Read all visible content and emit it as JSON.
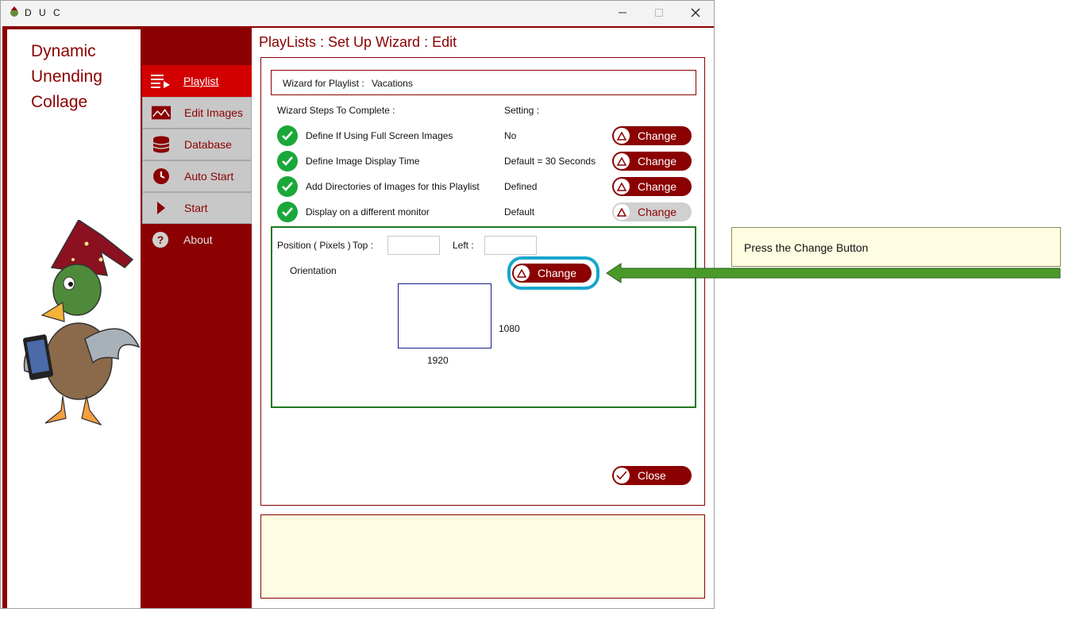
{
  "window": {
    "title": "D U C",
    "minimize_icon": "minimize-icon",
    "maximize_icon": "maximize-icon",
    "close_icon": "close-icon"
  },
  "brand": {
    "line1": "Dynamic",
    "line2": "Unending",
    "line3": "Collage",
    "mascot": "duck-wizard-mascot"
  },
  "nav": {
    "items": [
      {
        "label": "Playlist",
        "icon": "playlist-icon",
        "state": "active"
      },
      {
        "label": "Edit Images",
        "icon": "image-icon",
        "state": "normal"
      },
      {
        "label": "Database",
        "icon": "database-icon",
        "state": "normal"
      },
      {
        "label": "Auto Start",
        "icon": "clock-icon",
        "state": "normal"
      },
      {
        "label": "Start",
        "icon": "play-icon",
        "state": "normal"
      },
      {
        "label": "About",
        "icon": "help-icon",
        "state": "plain"
      }
    ]
  },
  "page": {
    "title": "PlayLists : Set Up Wizard : Edit",
    "playlist_label": "Wizard for Playlist :",
    "playlist_name": "Vacations",
    "steps_header": "Wizard Steps To Complete :",
    "setting_header": "Setting :",
    "steps": [
      {
        "label": "Define If Using Full Screen Images",
        "setting": "No",
        "button": "Change",
        "enabled": true
      },
      {
        "label": "Define Image Display Time",
        "setting": "Default = 30 Seconds",
        "button": "Change",
        "enabled": true
      },
      {
        "label": "Add Directories of Images for this Playlist",
        "setting": "Defined",
        "button": "Change",
        "enabled": true
      },
      {
        "label": "Display on a different monitor",
        "setting": "Default",
        "button": "Change",
        "enabled": false
      }
    ],
    "monitor": {
      "position_label": "Position ( Pixels )",
      "top_label": "Top :",
      "top_value": "",
      "left_label": "Left :",
      "left_value": "",
      "orientation_label": "Orientation",
      "change_button": "Change",
      "width": "1920",
      "height": "1080"
    },
    "close_button": "Close",
    "message": ""
  },
  "callout": {
    "text": "Press the Change Button"
  },
  "colors": {
    "brand": "#8b0000",
    "active_nav": "#d20000",
    "check": "#1aa83a",
    "highlight": "#18a6cc",
    "arrow": "#4a9a2a",
    "note_bg": "#fffde1"
  }
}
